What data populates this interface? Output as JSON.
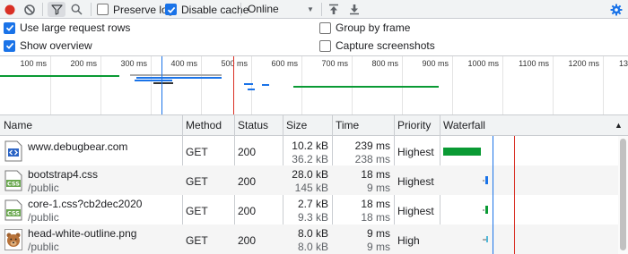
{
  "toolbar": {
    "preserve_log": {
      "label": "Preserve log",
      "checked": false
    },
    "disable_cache": {
      "label": "Disable cache",
      "checked": true
    },
    "throttling": {
      "value": "Online"
    },
    "icons": [
      "record-icon",
      "clear-icon",
      "filter-icon",
      "search-icon",
      "import-har-icon",
      "export-har-icon",
      "settings-gear-icon"
    ]
  },
  "settings": {
    "large_rows": {
      "label": "Use large request rows",
      "checked": true
    },
    "show_overview": {
      "label": "Show overview",
      "checked": true
    },
    "group_by_frame": {
      "label": "Group by frame",
      "checked": false
    },
    "capture_screenshots": {
      "label": "Capture screenshots",
      "checked": false
    }
  },
  "overview": {
    "ticks": [
      "100 ms",
      "200 ms",
      "300 ms",
      "400 ms",
      "500 ms",
      "600 ms",
      "700 ms",
      "800 ms",
      "900 ms",
      "1000 ms",
      "1100 ms",
      "1200 ms",
      "13"
    ]
  },
  "table": {
    "headers": {
      "name": "Name",
      "method": "Method",
      "status": "Status",
      "size": "Size",
      "time": "Time",
      "priority": "Priority",
      "waterfall": "Waterfall",
      "sort_indicator": "▲"
    },
    "rows": [
      {
        "name": "www.debugbear.com",
        "path": "",
        "icon": "html-document-icon",
        "method": "GET",
        "status": "200",
        "size_transferred": "10.2 kB",
        "size_resource": "36.2 kB",
        "time_total": "239 ms",
        "time_latency": "238 ms",
        "priority": "Highest"
      },
      {
        "name": "bootstrap4.css",
        "path": "/public",
        "icon": "css-file-icon",
        "method": "GET",
        "status": "200",
        "size_transferred": "28.0 kB",
        "size_resource": "145 kB",
        "time_total": "18 ms",
        "time_latency": "9 ms",
        "priority": "Highest"
      },
      {
        "name": "core-1.css?cb2dec2020",
        "path": "/public",
        "icon": "css-file-icon",
        "method": "GET",
        "status": "200",
        "size_transferred": "2.7 kB",
        "size_resource": "9.3 kB",
        "time_total": "18 ms",
        "time_latency": "18 ms",
        "priority": "Highest"
      },
      {
        "name": "head-white-outline.png",
        "path": "/public",
        "icon": "png-image-thumbnail-icon",
        "method": "GET",
        "status": "200",
        "size_transferred": "8.0 kB",
        "size_resource": "8.0 kB",
        "time_total": "9 ms",
        "time_latency": "9 ms",
        "priority": "High"
      }
    ]
  },
  "colors": {
    "record": "#d93025",
    "accent": "#1a73e8",
    "bar_green": "#0a9a34",
    "bar_blue": "#1a73e8",
    "dom_content_loaded_line": "#1a73e8",
    "load_line": "#d93025",
    "css_icon": "#6aa84f"
  }
}
